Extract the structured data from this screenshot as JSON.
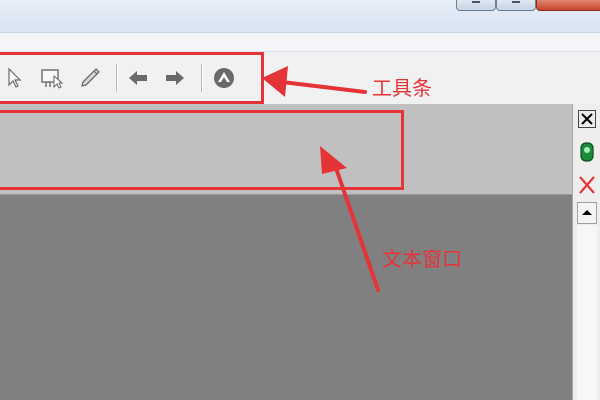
{
  "window": {
    "buttons": [
      "minimize",
      "maximize",
      "close"
    ]
  },
  "toolbar": {
    "icons": [
      "select-arrow-icon",
      "text-tool-icon",
      "pencil-icon",
      "back-arrow-icon",
      "forward-arrow-icon",
      "graphic-icon"
    ]
  },
  "annotations": {
    "toolbar_label": "工具条",
    "text_window_label": "文本窗口",
    "color": "#e53437"
  },
  "colors": {
    "text_window_bg": "#c0c0c0",
    "workspace_bg": "#808080",
    "toolbar_bg": "#f1f1f1"
  }
}
